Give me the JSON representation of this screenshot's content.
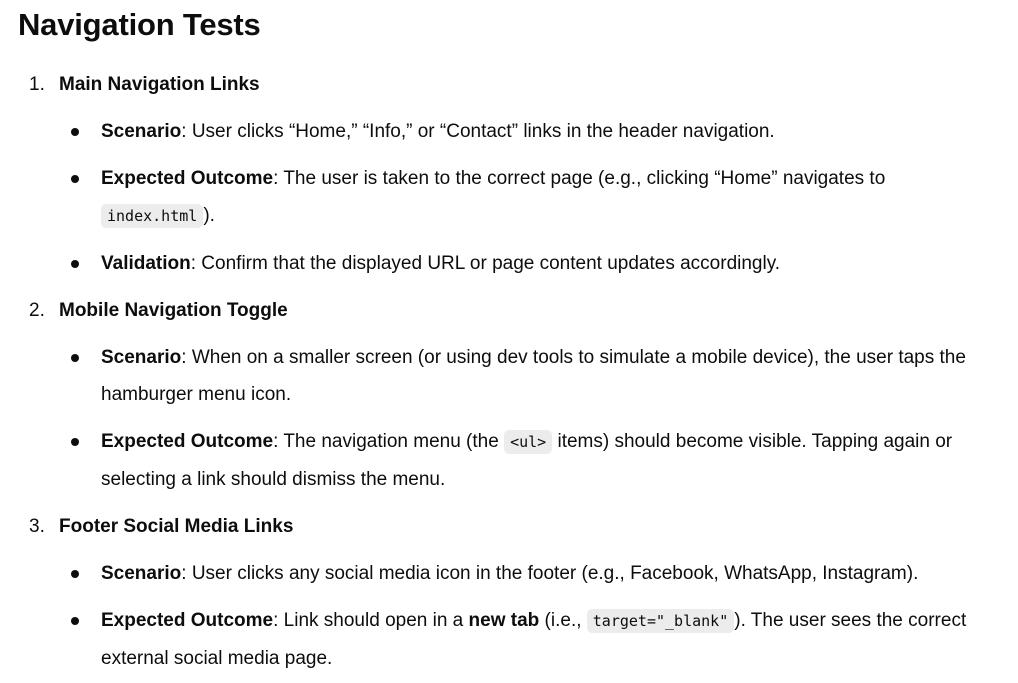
{
  "heading": "Navigation Tests",
  "items": [
    {
      "number": "1.",
      "title": "Main Navigation Links",
      "bullets": [
        {
          "label": "Scenario",
          "t1": ": User clicks “Home,” “Info,” or “Contact” links in the header navigation."
        },
        {
          "label": "Expected Outcome",
          "t1": ": The user is taken to the correct page (e.g., clicking “Home” navigates to ",
          "code1": "index.html",
          "t2": ")."
        },
        {
          "label": "Validation",
          "t1": ": Confirm that the displayed URL or page content updates accordingly."
        }
      ]
    },
    {
      "number": "2.",
      "title": "Mobile Navigation Toggle",
      "bullets": [
        {
          "label": "Scenario",
          "t1": ": When on a smaller screen (or using dev tools to simulate a mobile device), the user taps the hamburger menu icon."
        },
        {
          "label": "Expected Outcome",
          "t1": ": The navigation menu (the ",
          "code1": "<ul>",
          "t2": " items) should become visible. Tapping again or selecting a link should dismiss the menu."
        }
      ]
    },
    {
      "number": "3.",
      "title": "Footer Social Media Links",
      "bullets": [
        {
          "label": "Scenario",
          "t1": ": User clicks any social media icon in the footer (e.g., Facebook, WhatsApp, Instagram)."
        },
        {
          "label": "Expected Outcome",
          "t1": ": Link should open in a ",
          "bold2": "new tab",
          "t2": " (i.e., ",
          "code1": "target=\"_blank\"",
          "t3": "). The user sees the correct external social media page."
        }
      ]
    }
  ]
}
